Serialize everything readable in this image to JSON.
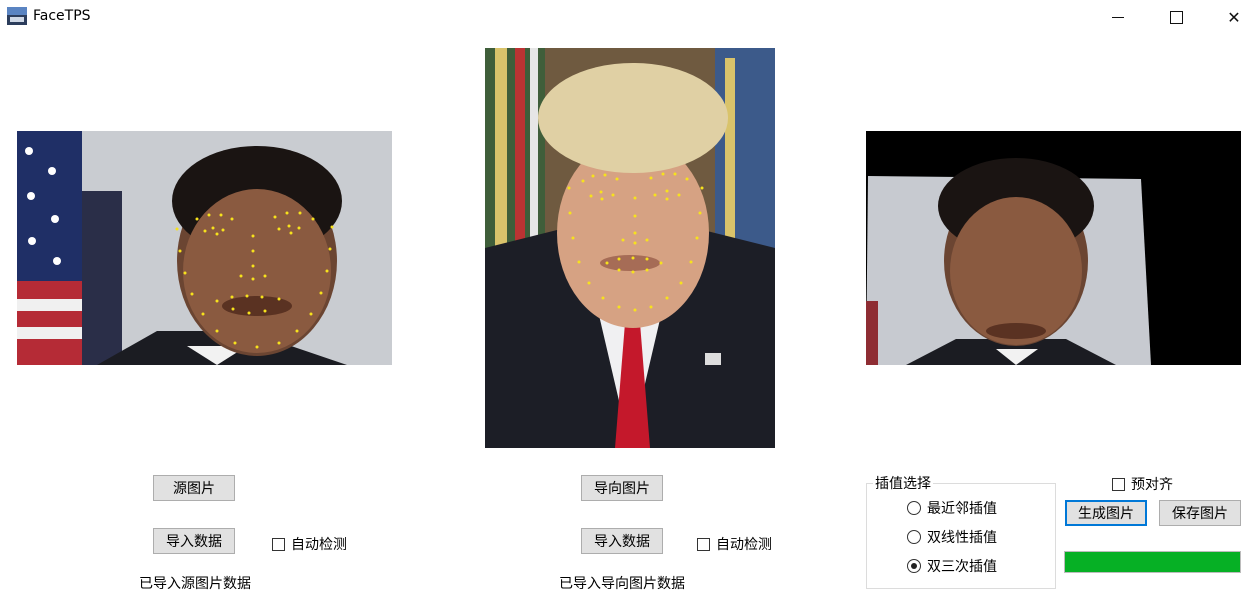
{
  "window": {
    "title": "FaceTPS",
    "icon": "app-photo-icon",
    "controls": {
      "minimize": "minimize-icon",
      "maximize": "maximize-icon",
      "close": "close-icon"
    }
  },
  "source": {
    "image_button": "源图片",
    "import_button": "导入数据",
    "auto_detect_label": "自动检测",
    "auto_detect_checked": false,
    "status": "已导入源图片数据"
  },
  "target": {
    "image_button": "导向图片",
    "import_button": "导入数据",
    "auto_detect_label": "自动检测",
    "auto_detect_checked": false,
    "status": "已导入导向图片数据"
  },
  "interpolation": {
    "legend": "插值选择",
    "options": [
      {
        "label": "最近邻插值",
        "selected": false
      },
      {
        "label": "双线性插值",
        "selected": false
      },
      {
        "label": "双三次插值",
        "selected": true
      }
    ]
  },
  "output": {
    "prealign_label": "预对齐",
    "prealign_checked": false,
    "generate_button": "生成图片",
    "save_button": "保存图片",
    "progress": 1.0,
    "progress_color": "#06b025"
  }
}
